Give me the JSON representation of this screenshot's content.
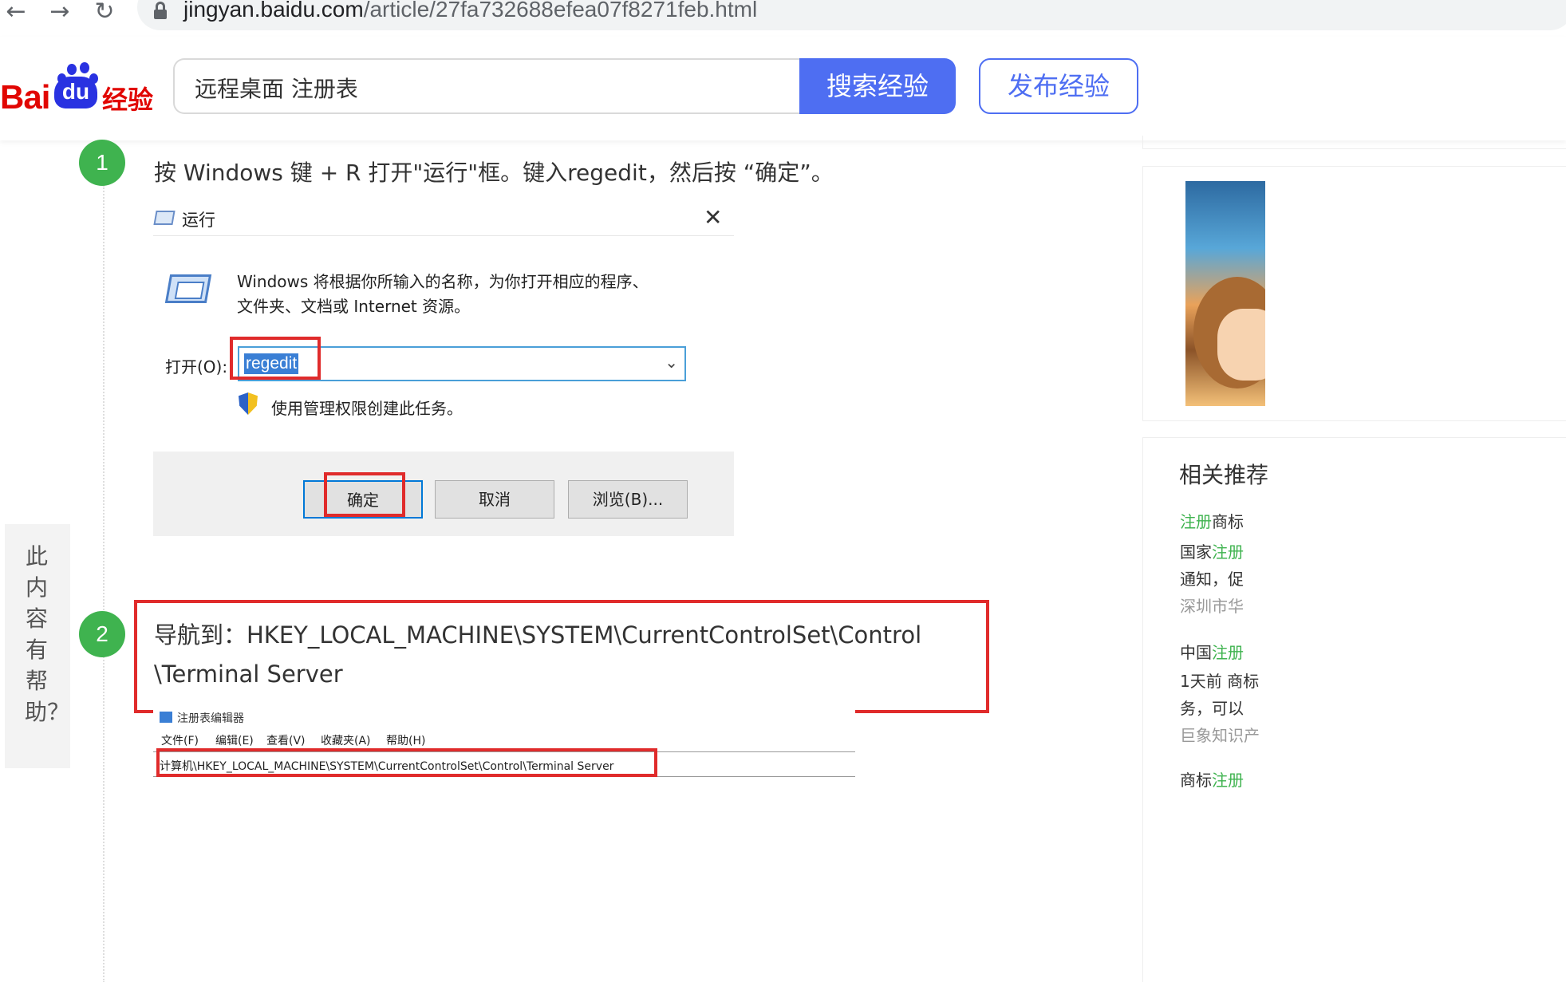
{
  "browser": {
    "back": "←",
    "forward": "→",
    "reload": "↻",
    "url_host": "jingyan.baidu.com",
    "url_path": "/article/27fa732688efea07f8271feb.html"
  },
  "header": {
    "logo_bai": "Bai",
    "logo_du": "du",
    "logo_jingyan": "经验",
    "search_value": "远程桌面 注册表",
    "search_button": "搜索经验",
    "publish_button": "发布经验"
  },
  "steps": [
    {
      "number": "1",
      "text": "按 Windows 键 + R 打开\"运行\"框。键入regedit，然后按 “确定”。"
    },
    {
      "number": "2",
      "line1": "导航到：HKEY_LOCAL_MACHINE\\SYSTEM\\CurrentControlSet\\Control",
      "line2": "\\Terminal Server"
    }
  ],
  "run_dialog": {
    "title": "运行",
    "close": "✕",
    "desc_line1": "Windows 将根据你所输入的名称，为你打开相应的程序、",
    "desc_line2": "文件夹、文档或 Internet 资源。",
    "open_label": "打开(O):",
    "input_value": "regedit",
    "chevron": "⌄",
    "admin_text": "使用管理权限创建此任务。",
    "ok_button": "确定",
    "cancel_button": "取消",
    "browse_button": "浏览(B)..."
  },
  "registry_editor": {
    "title": "注册表编辑器",
    "menu": [
      "文件(F)",
      "编辑(E)",
      "查看(V)",
      "收藏夹(A)",
      "帮助(H)"
    ],
    "address": "计算机\\HKEY_LOCAL_MACHINE\\SYSTEM\\CurrentControlSet\\Control\\Terminal Server"
  },
  "float_help": {
    "text": "此内容有帮助？"
  },
  "sidebar": {
    "related_title": "相关推荐",
    "items": [
      {
        "l1_hl": "注册",
        "l1": "商标",
        "l2_pre": "国家",
        "l2_hl": "注册",
        "l3": "通知，促",
        "src": "深圳市华"
      },
      {
        "l1_pre": "中国",
        "l1_hl": "注册",
        "l2": "1天前 商标",
        "l3": "务，可以",
        "src": "巨象知识产"
      },
      {
        "l1_pre": "商标",
        "l1_hl": "注册"
      }
    ]
  },
  "colors": {
    "accent": "#4e6ef2",
    "baidu_red": "#e10602",
    "baidu_blue": "#2932e1",
    "step_green": "#3fb34f",
    "highlight_red": "#e02b2b"
  }
}
